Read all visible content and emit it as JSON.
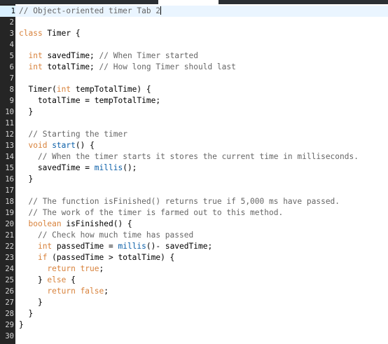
{
  "colors": {
    "keyword": "#d8823b",
    "function": "#0b5fa8",
    "comment": "#666666",
    "text": "#000000",
    "gutter": "#252525",
    "current_line": "#eaf5ff"
  },
  "editor": {
    "current_line": 1,
    "lines": [
      {
        "n": "1",
        "tokens": [
          {
            "t": "// Object-oriented timer Tab 2",
            "c": "cm"
          }
        ]
      },
      {
        "n": "2",
        "tokens": []
      },
      {
        "n": "3",
        "tokens": [
          {
            "t": "class",
            "c": "kw"
          },
          {
            "t": " Timer {",
            "c": ""
          }
        ]
      },
      {
        "n": "4",
        "tokens": []
      },
      {
        "n": "5",
        "tokens": [
          {
            "t": "  ",
            "c": ""
          },
          {
            "t": "int",
            "c": "kw"
          },
          {
            "t": " savedTime; ",
            "c": ""
          },
          {
            "t": "// When Timer started",
            "c": "cm"
          }
        ]
      },
      {
        "n": "6",
        "tokens": [
          {
            "t": "  ",
            "c": ""
          },
          {
            "t": "int",
            "c": "kw"
          },
          {
            "t": " totalTime; ",
            "c": ""
          },
          {
            "t": "// How long Timer should last",
            "c": "cm"
          }
        ]
      },
      {
        "n": "7",
        "tokens": []
      },
      {
        "n": "8",
        "tokens": [
          {
            "t": "  Timer(",
            "c": ""
          },
          {
            "t": "int",
            "c": "kw"
          },
          {
            "t": " tempTotalTime) {",
            "c": ""
          }
        ]
      },
      {
        "n": "9",
        "tokens": [
          {
            "t": "    totalTime = tempTotalTime;",
            "c": ""
          }
        ]
      },
      {
        "n": "10",
        "tokens": [
          {
            "t": "  }",
            "c": ""
          }
        ]
      },
      {
        "n": "11",
        "tokens": []
      },
      {
        "n": "12",
        "tokens": [
          {
            "t": "  ",
            "c": ""
          },
          {
            "t": "// Starting the timer",
            "c": "cm"
          }
        ]
      },
      {
        "n": "13",
        "tokens": [
          {
            "t": "  ",
            "c": ""
          },
          {
            "t": "void",
            "c": "kw"
          },
          {
            "t": " ",
            "c": ""
          },
          {
            "t": "start",
            "c": "fn"
          },
          {
            "t": "() {",
            "c": ""
          }
        ]
      },
      {
        "n": "14",
        "tokens": [
          {
            "t": "    ",
            "c": ""
          },
          {
            "t": "// When the timer starts it stores the current time in milliseconds.",
            "c": "cm"
          }
        ]
      },
      {
        "n": "15",
        "tokens": [
          {
            "t": "    savedTime = ",
            "c": ""
          },
          {
            "t": "millis",
            "c": "fn"
          },
          {
            "t": "();",
            "c": ""
          }
        ]
      },
      {
        "n": "16",
        "tokens": [
          {
            "t": "  }",
            "c": ""
          }
        ]
      },
      {
        "n": "17",
        "tokens": []
      },
      {
        "n": "18",
        "tokens": [
          {
            "t": "  ",
            "c": ""
          },
          {
            "t": "// The function isFinished() returns true if 5,000 ms have passed.",
            "c": "cm"
          }
        ]
      },
      {
        "n": "19",
        "tokens": [
          {
            "t": "  ",
            "c": ""
          },
          {
            "t": "// The work of the timer is farmed out to this method.",
            "c": "cm"
          }
        ]
      },
      {
        "n": "20",
        "tokens": [
          {
            "t": "  ",
            "c": ""
          },
          {
            "t": "boolean",
            "c": "kw"
          },
          {
            "t": " isFinished() {",
            "c": ""
          }
        ]
      },
      {
        "n": "21",
        "tokens": [
          {
            "t": "    ",
            "c": ""
          },
          {
            "t": "// Check how much time has passed",
            "c": "cm"
          }
        ]
      },
      {
        "n": "22",
        "tokens": [
          {
            "t": "    ",
            "c": ""
          },
          {
            "t": "int",
            "c": "kw"
          },
          {
            "t": " passedTime = ",
            "c": ""
          },
          {
            "t": "millis",
            "c": "fn"
          },
          {
            "t": "()- savedTime;",
            "c": ""
          }
        ]
      },
      {
        "n": "23",
        "tokens": [
          {
            "t": "    ",
            "c": ""
          },
          {
            "t": "if",
            "c": "kw"
          },
          {
            "t": " (passedTime > totalTime) {",
            "c": ""
          }
        ]
      },
      {
        "n": "24",
        "tokens": [
          {
            "t": "      ",
            "c": ""
          },
          {
            "t": "return true",
            "c": "kw"
          },
          {
            "t": ";",
            "c": ""
          }
        ]
      },
      {
        "n": "25",
        "tokens": [
          {
            "t": "    } ",
            "c": ""
          },
          {
            "t": "else",
            "c": "kw"
          },
          {
            "t": " {",
            "c": ""
          }
        ]
      },
      {
        "n": "26",
        "tokens": [
          {
            "t": "      ",
            "c": ""
          },
          {
            "t": "return false",
            "c": "kw"
          },
          {
            "t": ";",
            "c": ""
          }
        ]
      },
      {
        "n": "27",
        "tokens": [
          {
            "t": "    }",
            "c": ""
          }
        ]
      },
      {
        "n": "28",
        "tokens": [
          {
            "t": "  }",
            "c": ""
          }
        ]
      },
      {
        "n": "29",
        "tokens": [
          {
            "t": "}",
            "c": ""
          }
        ]
      },
      {
        "n": "30",
        "tokens": []
      }
    ]
  }
}
